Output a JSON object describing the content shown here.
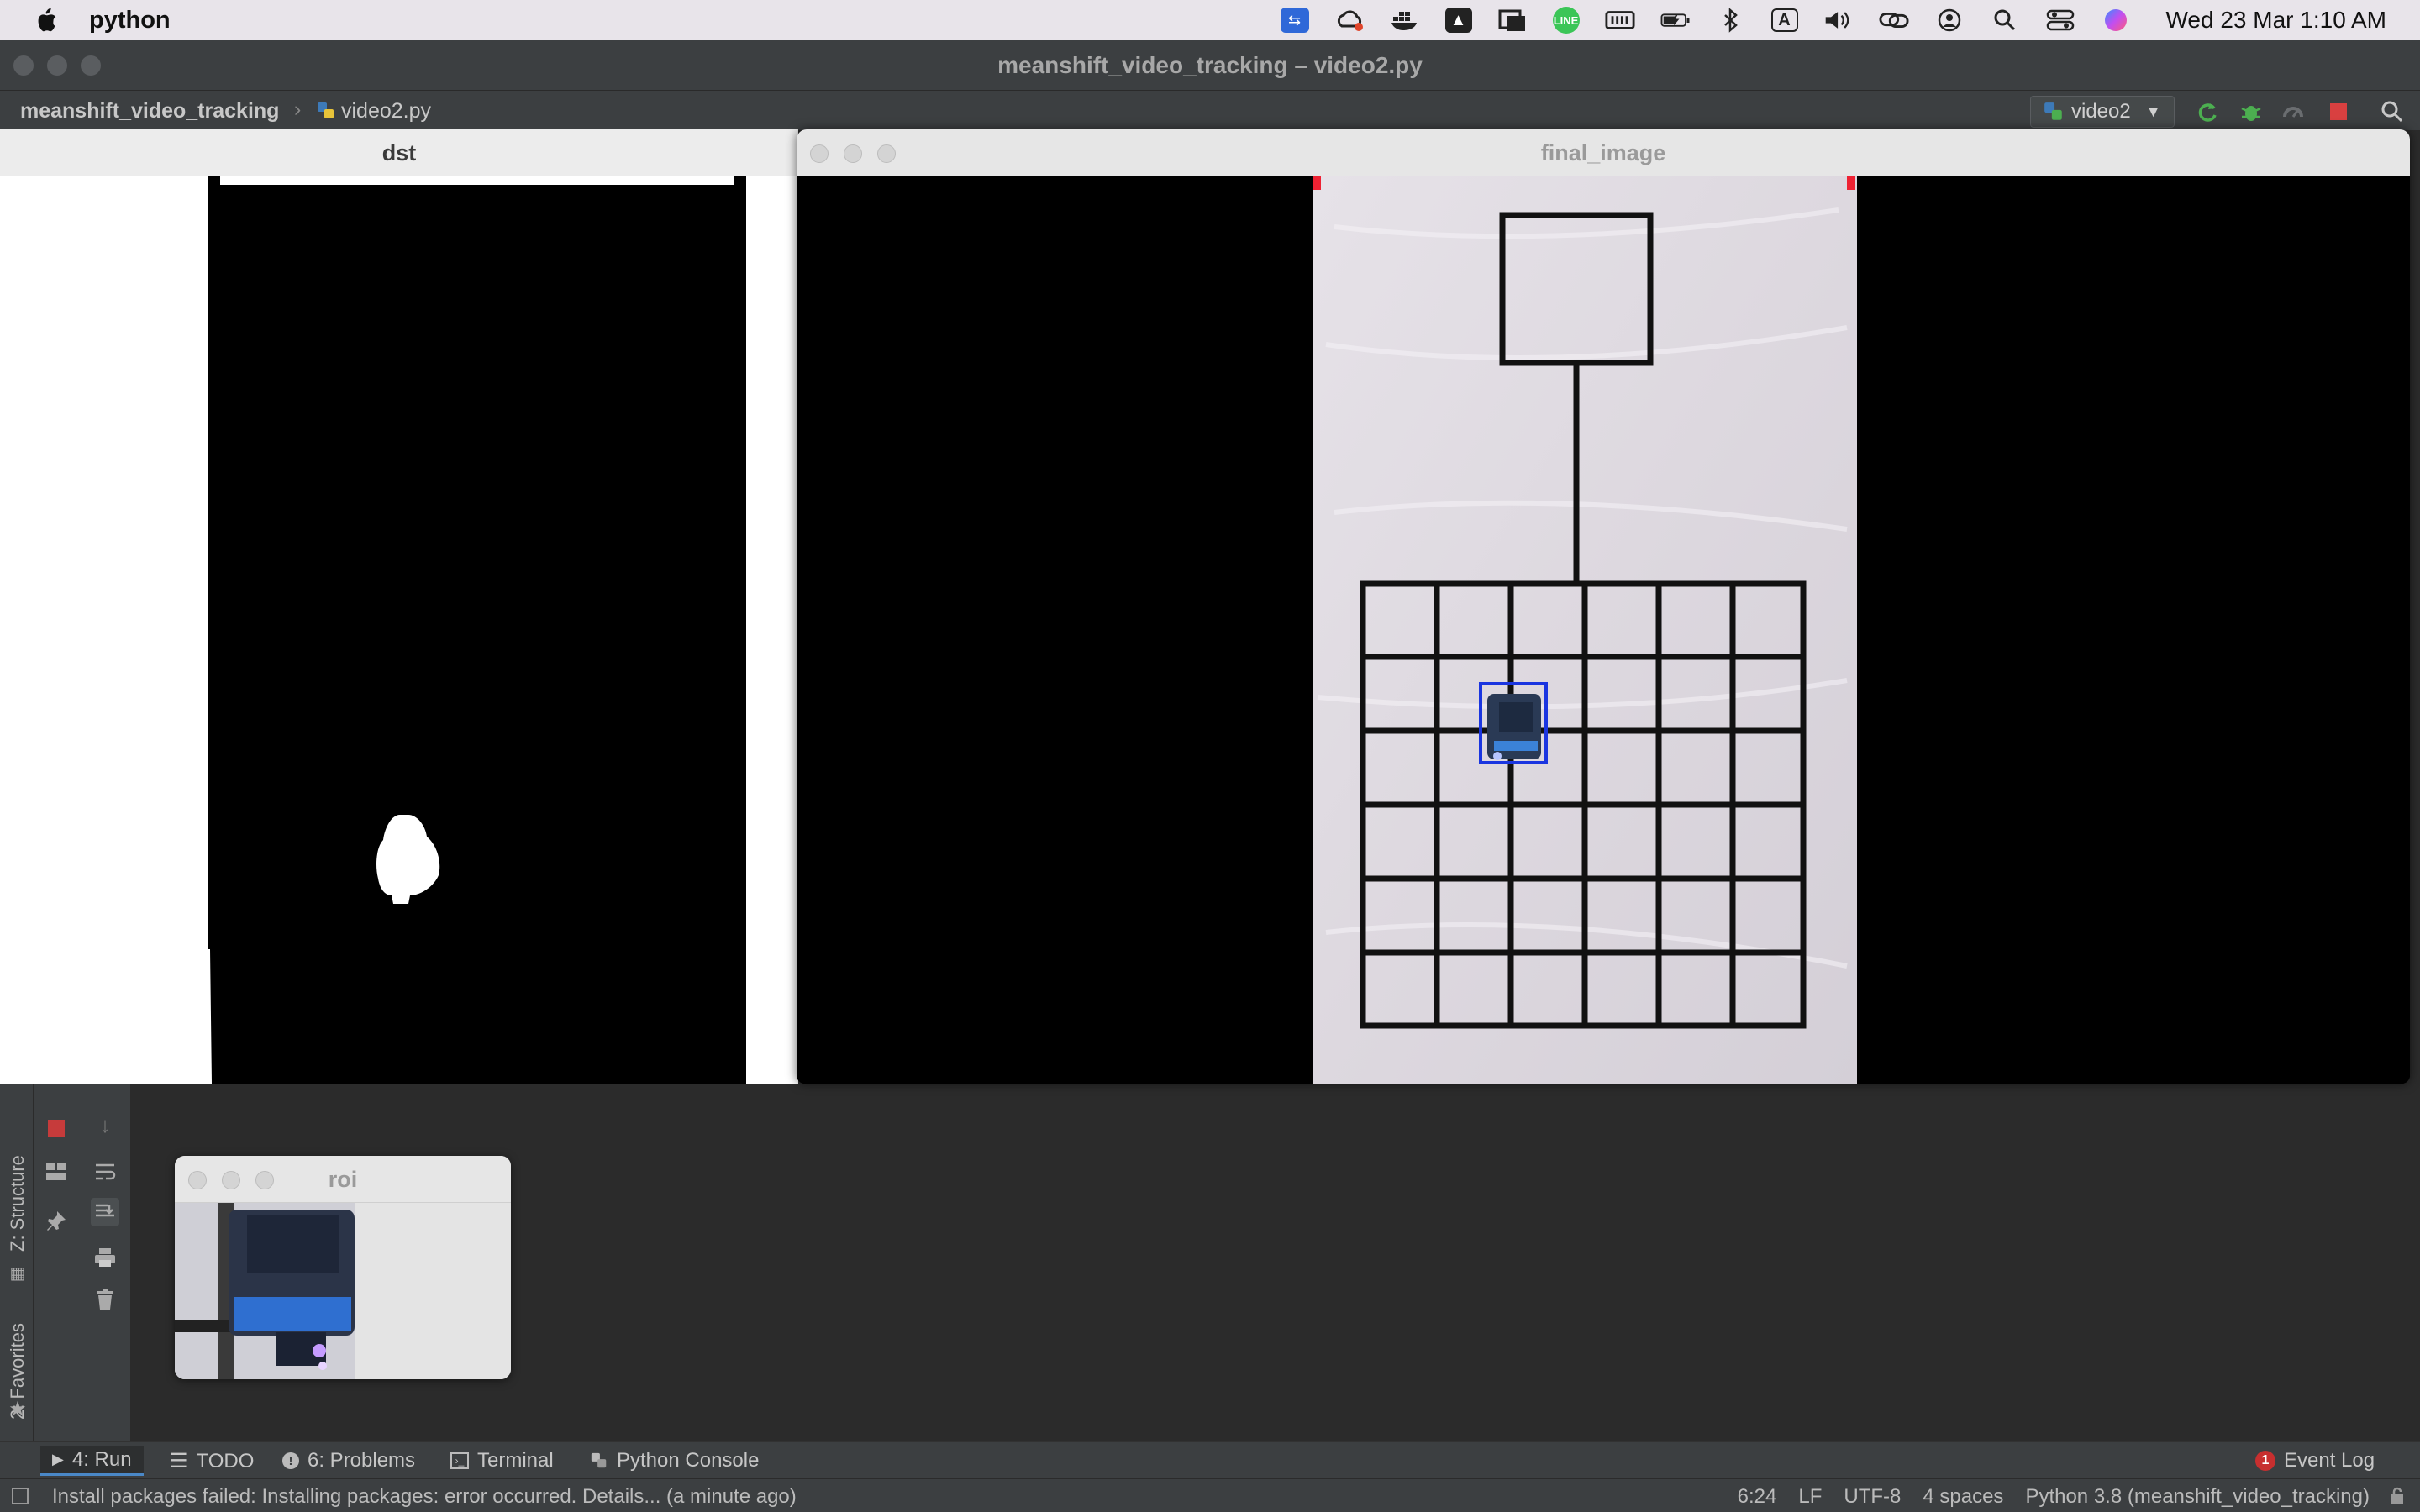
{
  "menubar": {
    "app_name": "python",
    "clock": "Wed 23 Mar  1:10 AM",
    "tray_icons": [
      "teamviewer-icon",
      "creative-cloud-icon",
      "docker-icon",
      "google-drive-icon",
      "image-capture-icon",
      "line-icon",
      "memory-icon",
      "battery-icon",
      "bluetooth-icon",
      "input-source-icon",
      "volume-icon",
      "link-icon",
      "user-icon",
      "spotlight-icon",
      "control-center-icon",
      "siri-icon"
    ],
    "input_source_letter": "A",
    "line_label": "LINE"
  },
  "ide": {
    "window_title": "meanshift_video_tracking – video2.py",
    "breadcrumb_project": "meanshift_video_tracking",
    "breadcrumb_file": "video2.py",
    "run_config": "video2"
  },
  "windows": {
    "dst_title": "dst",
    "final_title": "final_image",
    "roi_title": "roi"
  },
  "left_tabs": {
    "structure": "Z: Structure",
    "favorites": "2: Favorites"
  },
  "bottom_tabs": {
    "run": "4: Run",
    "todo": "TODO",
    "problems": "6: Problems",
    "terminal": "Terminal",
    "python_console": "Python Console",
    "event_log": "Event Log",
    "event_log_count": "1"
  },
  "status": {
    "message": "Install packages failed: Installing packages: error occurred. Details... (a minute ago)",
    "position": "6:24",
    "line_sep": "LF",
    "encoding": "UTF-8",
    "indent": "4 spaces",
    "interpreter": "Python 3.8 (meanshift_video_tracking)"
  },
  "colors": {
    "tracking_box": "#1a35e0",
    "run_green": "#4caf50",
    "stop_red": "#d94040"
  }
}
